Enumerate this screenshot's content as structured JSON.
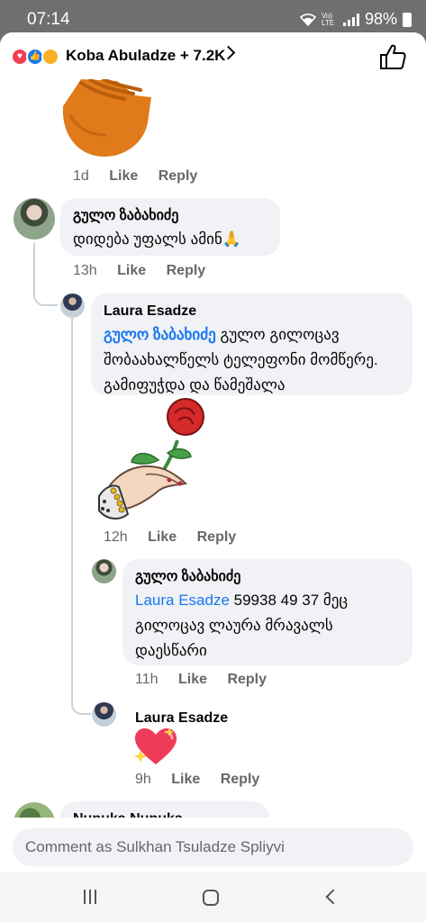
{
  "status_bar": {
    "time": "07:14",
    "network": "Vo) LTE",
    "battery": "98%"
  },
  "header": {
    "title": "Koba Abuladze + 7.2K",
    "reactions": [
      "love-icon",
      "like-icon",
      "care-icon"
    ]
  },
  "comments": [
    {
      "age": "1d",
      "like": "Like",
      "reply": "Reply",
      "sticker": "clapping-hands-sticker"
    },
    {
      "author": "გულო ზაბახიძე",
      "text": "დიდება უფალს ამინ🙏",
      "age": "13h",
      "like": "Like",
      "reply": "Reply"
    },
    {
      "author": "Laura Esadze",
      "mention": "გულო ზაბახიძე",
      "text": " გულო გილოცავ შობაახალწელს ტელეფონი მომწერე. გამიფუჭდა და წამეშალა",
      "age": "12h",
      "like": "Like",
      "reply": "Reply",
      "sticker": "rose-in-hand-sticker"
    },
    {
      "author": "გულო ზაბახიძე",
      "mention": "Laura Esadze",
      "text": "  59938 49 37  მეც გილოცავ ლაურა მრავალს დაესწარი",
      "age": "11h",
      "like": "Like",
      "reply": "Reply"
    },
    {
      "author": "Laura Esadze",
      "age": "9h",
      "like": "Like",
      "reply": "Reply",
      "sticker": "sparkling-heart-sticker"
    },
    {
      "author": "Nunuka Nunuka"
    }
  ],
  "composer": {
    "placeholder": "Comment as Sulkhan Tsuladze Spliyvi"
  },
  "nav": [
    "recent-apps-icon",
    "home-icon",
    "back-icon"
  ]
}
